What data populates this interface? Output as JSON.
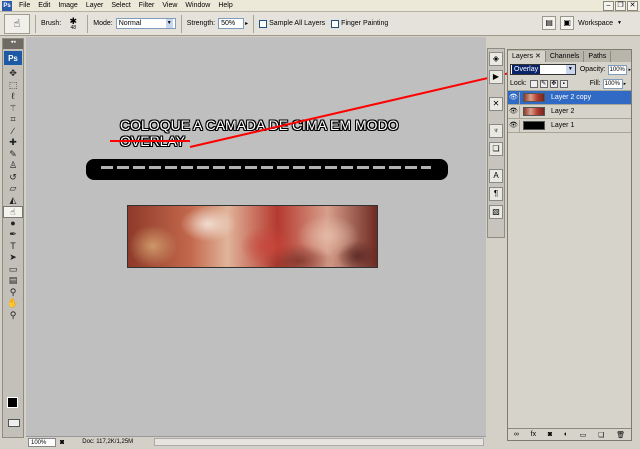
{
  "menubar": {
    "items": [
      "File",
      "Edit",
      "Image",
      "Layer",
      "Select",
      "Filter",
      "View",
      "Window",
      "Help"
    ],
    "app_icon": "Ps"
  },
  "options": {
    "brush_label": "Brush:",
    "brush_size": "48",
    "mode_label": "Mode:",
    "mode_value": "Normal",
    "strength_label": "Strength:",
    "strength_value": "50%",
    "sample_all_layers": "Sample All Layers",
    "finger_painting": "Finger Painting",
    "workspace_label": "Workspace"
  },
  "toolbox": {
    "logo": "Ps"
  },
  "canvas": {
    "annotation_line1": "COLOQUE A CAMADA DE CIMA EM MODO",
    "annotation_line2": "OVERLAY",
    "line_color": "#ff0000"
  },
  "statusbar": {
    "zoom": "100%",
    "doc_info": "Doc: 117,2K/1,25M"
  },
  "layers": {
    "tabs": [
      "Layers",
      "Channels",
      "Paths"
    ],
    "blend_mode": "Overlay",
    "opacity_label": "Opacity:",
    "opacity_value": "100%",
    "lock_label": "Lock:",
    "fill_label": "Fill:",
    "fill_value": "100%",
    "items": [
      {
        "name": "Layer 2 copy",
        "thumb": "red",
        "selected": true
      },
      {
        "name": "Layer 2",
        "thumb": "red",
        "selected": false
      },
      {
        "name": "Layer 1",
        "thumb": "black",
        "selected": false
      }
    ],
    "footer_icons": [
      "link-icon",
      "fx-icon",
      "mask-icon",
      "adjustment-icon",
      "group-icon",
      "new-layer-icon",
      "trash-icon"
    ]
  }
}
